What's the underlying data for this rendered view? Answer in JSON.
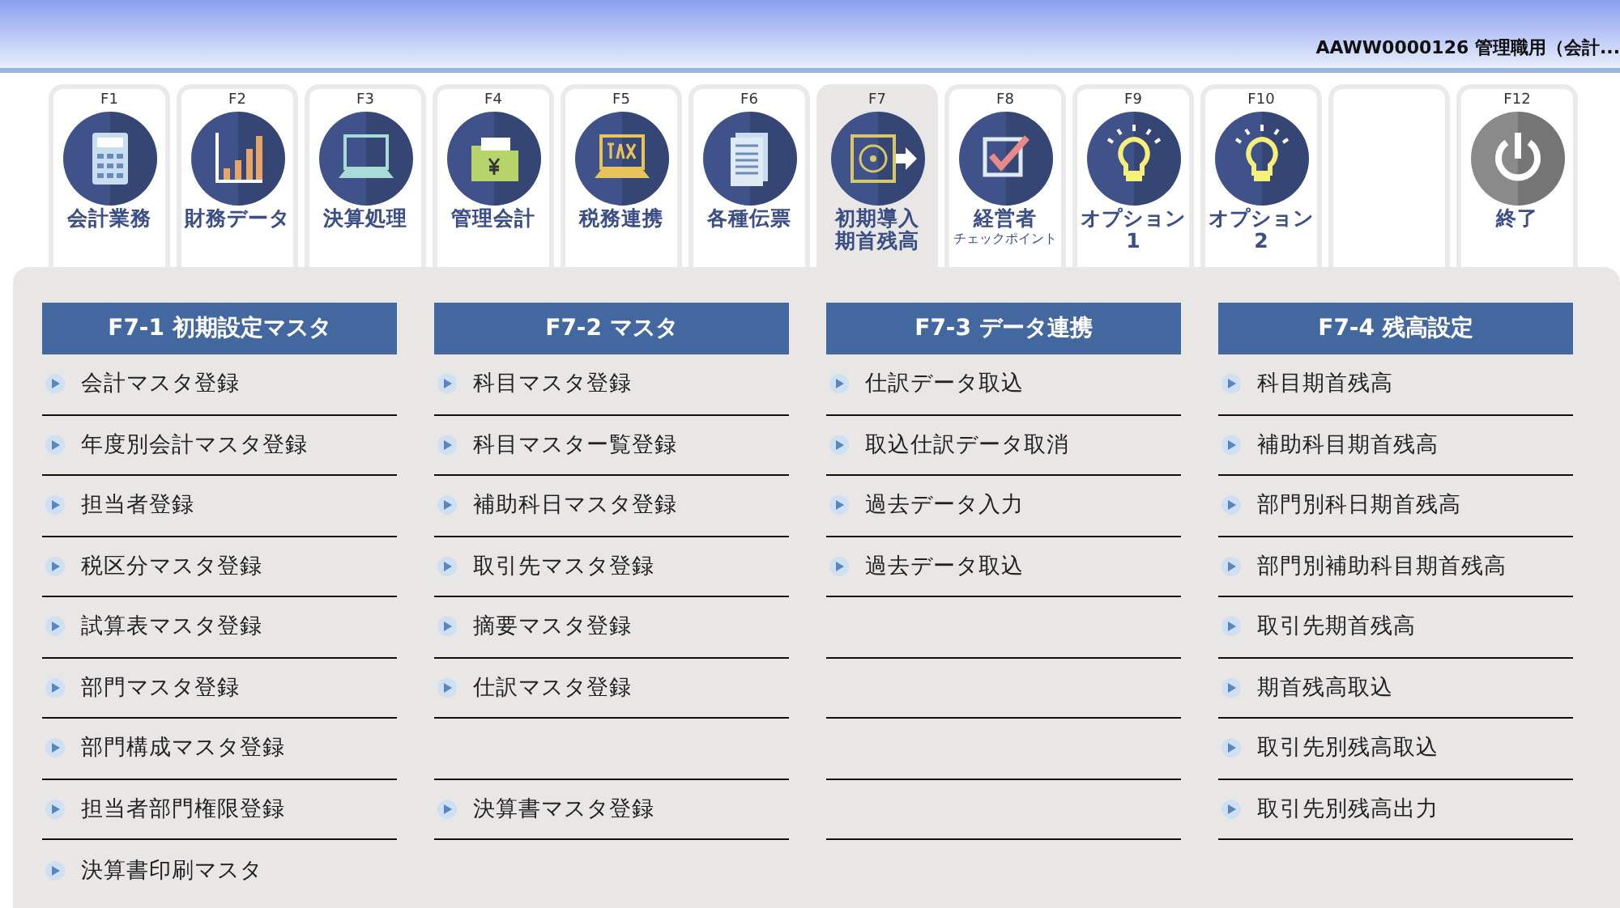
{
  "header": {
    "title": "AAWW0000126 管理職用（会計..."
  },
  "tabs": [
    {
      "key": "F1",
      "lines": [
        "会計業務"
      ],
      "selected": false
    },
    {
      "key": "F2",
      "lines": [
        "財務データ"
      ],
      "selected": false
    },
    {
      "key": "F3",
      "lines": [
        "決算処理"
      ],
      "selected": false
    },
    {
      "key": "F4",
      "lines": [
        "管理会計"
      ],
      "selected": false
    },
    {
      "key": "F5",
      "lines": [
        "税務連携"
      ],
      "selected": false
    },
    {
      "key": "F6",
      "lines": [
        "各種伝票"
      ],
      "selected": false
    },
    {
      "key": "F7",
      "lines": [
        "初期導入",
        "期首残高"
      ],
      "selected": true
    },
    {
      "key": "F8",
      "lines": [
        "経営者",
        "チェックポイント"
      ],
      "kind": "subline",
      "selected": false
    },
    {
      "key": "F9",
      "lines": [
        "オプション",
        "1"
      ],
      "selected": false
    },
    {
      "key": "F10",
      "lines": [
        "オプション",
        "2"
      ],
      "selected": false
    },
    {
      "kind": "blank",
      "selected": false
    },
    {
      "key": "F12",
      "lines": [
        "終了"
      ],
      "selected": false
    }
  ],
  "menus": [
    {
      "title": "F7-1 初期設定マスタ",
      "items": [
        {
          "label": "会計マスタ登録"
        },
        {
          "label": "年度別会計マスタ登録"
        },
        {
          "label": "担当者登録"
        },
        {
          "label": "税区分マスタ登録"
        },
        {
          "label": "試算表マスタ登録"
        },
        {
          "label": "部門マスタ登録"
        },
        {
          "label": "部門構成マスタ登録"
        },
        {
          "label": "担当者部門権限登録"
        },
        {
          "label": "決算書印刷マスタ",
          "kind": "last"
        }
      ]
    },
    {
      "title": "F7-2 マスタ",
      "items": [
        {
          "label": "科目マスタ登録"
        },
        {
          "label": "科目マスター覧登録"
        },
        {
          "label": "補助科日マスタ登録"
        },
        {
          "label": "取引先マスタ登録"
        },
        {
          "label": "摘要マスタ登録"
        },
        {
          "label": "仕訳マスタ登録"
        },
        {
          "kind": "empty"
        },
        {
          "label": "決算書マスタ登録"
        }
      ]
    },
    {
      "title": "F7-3 データ連携",
      "items": [
        {
          "label": "仕訳データ取込"
        },
        {
          "label": "取込仕訳データ取消"
        },
        {
          "label": "過去データ入力"
        },
        {
          "label": "過去データ取込"
        },
        {
          "kind": "empty"
        },
        {
          "kind": "empty"
        },
        {
          "kind": "empty"
        },
        {
          "kind": "empty"
        }
      ]
    },
    {
      "title": "F7-4 残高設定",
      "items": [
        {
          "label": "科目期首残高"
        },
        {
          "label": "補助科目期首残高"
        },
        {
          "label": "部門別科日期首残高"
        },
        {
          "label": "部門別補助科目期首残高"
        },
        {
          "label": "取引先期首残高"
        },
        {
          "label": "期首残高取込"
        },
        {
          "label": "取引先別残高取込"
        },
        {
          "label": "取引先別残高出力"
        }
      ]
    }
  ]
}
